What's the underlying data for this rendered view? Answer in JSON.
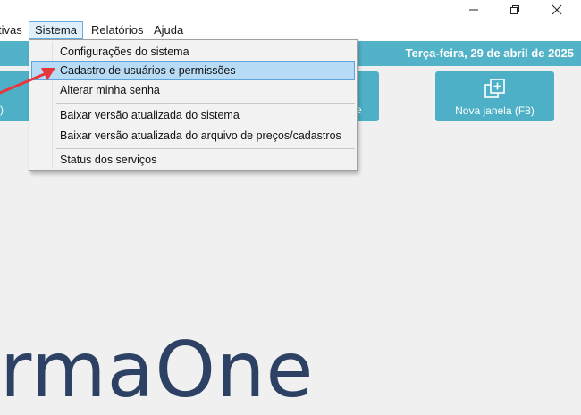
{
  "window": {
    "minimize_icon": "minimize-icon",
    "maximize_icon": "restore-icon",
    "close_icon": "close-icon"
  },
  "menubar": {
    "partial_label": "tivas",
    "items": [
      {
        "label": "Sistema"
      },
      {
        "label": "Relatórios"
      },
      {
        "label": "Ajuda"
      }
    ]
  },
  "header": {
    "date": "Terça-feira, 29 de abril de 2025",
    "color": "#52b2c8"
  },
  "tiles": {
    "left_partial_label": ")",
    "mid_partial_label": "e",
    "new_window_label": "Nova janela (F8)",
    "new_window_icon": "new-window-icon"
  },
  "dropdown": {
    "items": [
      {
        "label": "Configurações do sistema"
      },
      {
        "label": "Cadastro de usuários e permissões"
      },
      {
        "label": "Alterar minha senha"
      },
      {
        "label": "Baixar versão atualizada do sistema"
      },
      {
        "label": "Baixar versão atualizada do arquivo de preços/cadastros"
      },
      {
        "label": "Status dos serviços"
      }
    ],
    "highlight_color": "#b8dbf5"
  },
  "brand": {
    "text": "rmaOne",
    "color": "#2d4164"
  },
  "annotation": {
    "arrow_color": "#e8363c"
  }
}
